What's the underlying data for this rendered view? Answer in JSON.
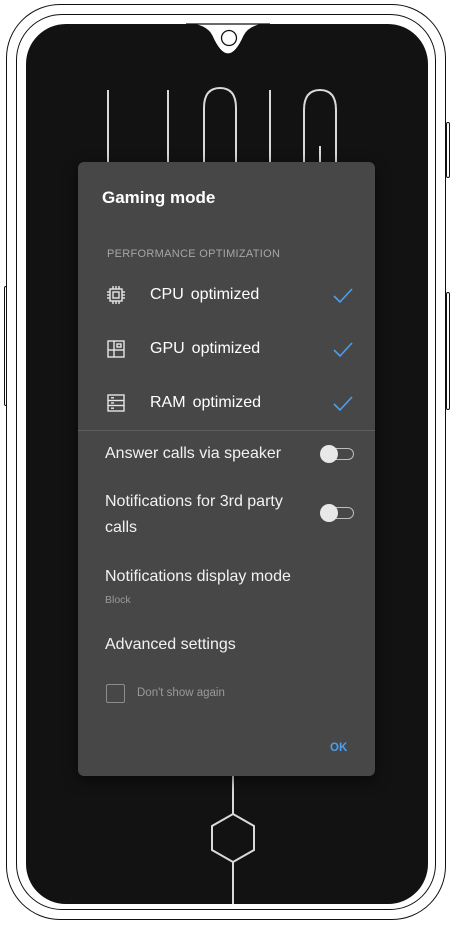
{
  "dialog": {
    "title": "Gaming mode",
    "section_header": "PERFORMANCE OPTIMIZATION",
    "performance_items": [
      {
        "name": "CPU",
        "status": "optimized",
        "icon": "cpu-chip-icon",
        "checked": true
      },
      {
        "name": "GPU",
        "status": "optimized",
        "icon": "gpu-icon",
        "checked": true
      },
      {
        "name": "RAM",
        "status": "optimized",
        "icon": "ram-icon",
        "checked": true
      }
    ],
    "settings": {
      "answer_calls": {
        "label": "Answer calls via speaker",
        "enabled": false
      },
      "third_party_notifications": {
        "label": "Notifications for 3rd party calls",
        "enabled": false
      },
      "notification_display_mode": {
        "label": "Notifications display mode",
        "value": "Block"
      },
      "advanced": {
        "label": "Advanced settings"
      }
    },
    "dont_show_again": {
      "label": "Don't show again",
      "checked": false
    },
    "ok_label": "OK"
  },
  "colors": {
    "dialog_bg": "#474747",
    "accent": "#4a9ff0",
    "screen_bg": "#121212",
    "wallpaper_lines": "#d9d9d9"
  }
}
